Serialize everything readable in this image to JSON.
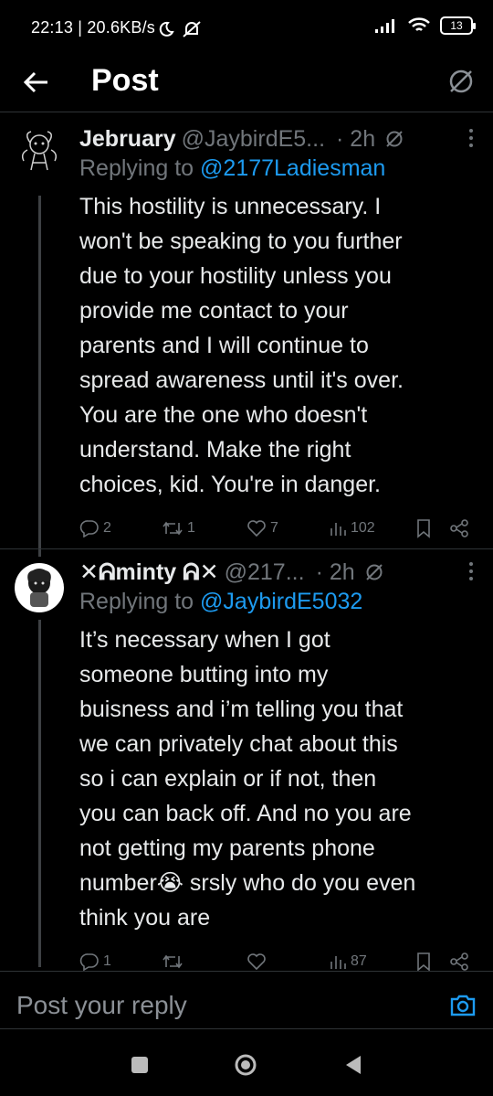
{
  "status_bar": {
    "time_info": "22:13 | 20.6KB/s",
    "battery_level": "13"
  },
  "app_bar": {
    "title": "Post"
  },
  "tweets": [
    {
      "name": "Jebruary",
      "handle": "@JaybirdE5...",
      "time": "· 2h",
      "replying_prefix": "Replying to ",
      "replying_to": "@2177Ladiesman",
      "lines": [
        "This hostility is unnecessary. I",
        "won't be speaking to you further",
        "due to your hostility unless you",
        "provide me contact to your",
        "parents and I will continue to",
        "spread awareness until it's over.",
        "You are the one who doesn't",
        "understand.  Make the right",
        "choices, kid. You're in danger."
      ],
      "replies": "2",
      "reposts": "1",
      "likes": "7",
      "views": "102"
    },
    {
      "name": "✕ᕱminty ᕱ✕",
      "handle": "@217...",
      "time": "· 2h",
      "replying_prefix": "Replying to ",
      "replying_to": "@JaybirdE5032",
      "lines": [
        "It’s necessary when I got",
        "someone butting into my",
        "buisness and i’m telling you that",
        "we can privately chat about this",
        "so i can explain or if not, then",
        "you can back off. And no you are",
        "not getting my parents phone",
        "number😭 srsly who do you even",
        "think you are"
      ],
      "replies": "1",
      "reposts": "",
      "likes": "",
      "views": "87"
    }
  ],
  "composer": {
    "placeholder": "Post your reply"
  },
  "colors": {
    "background": "#000000",
    "text": "#e7e9ea",
    "muted": "#71767b",
    "accent": "#1d9bf0"
  },
  "icons": [
    "back-arrow-icon",
    "circle-slash-icon",
    "more-vertical-icon",
    "reply-icon",
    "repost-icon",
    "like-icon",
    "views-icon",
    "bookmark-icon",
    "share-icon",
    "camera-icon"
  ]
}
